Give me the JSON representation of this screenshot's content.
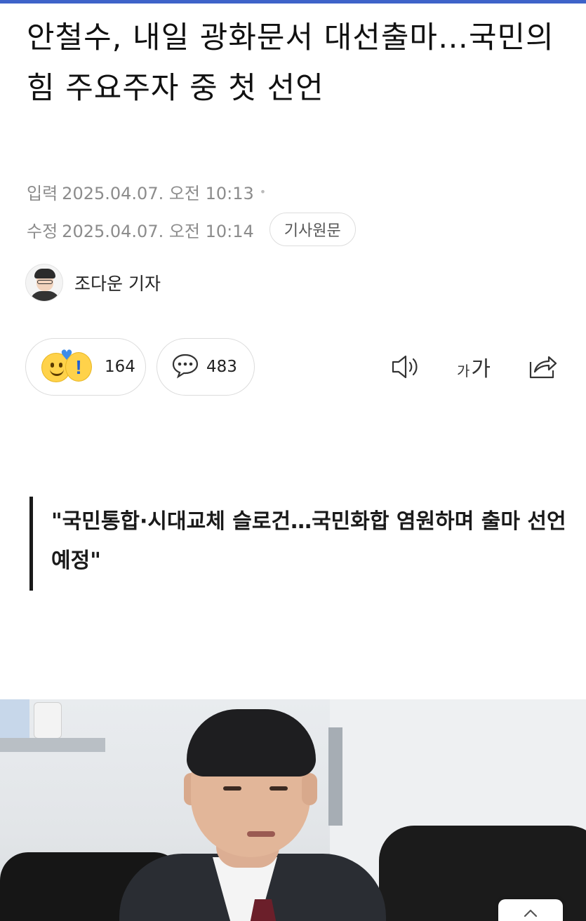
{
  "article": {
    "headline": "안철수, 내일 광화문서 대선출마…국민의힘 주요주자 중 첫 선언",
    "published_label": "입력",
    "published_value": "2025.04.07. 오전 10:13",
    "modified_label": "수정",
    "modified_value": "2025.04.07. 오전 10:14",
    "original_button": "기사원문",
    "author": "조다운 기자",
    "quote": "\"국민통합·시대교체 슬로건…국민화합 염원하며 출마 선언 예정\""
  },
  "actions": {
    "reaction_count": "164",
    "comment_count": "483",
    "font_size_large": "가",
    "font_size_small": "가"
  },
  "colors": {
    "accent": "#3e63c9",
    "quote_bar": "#1a1a1a",
    "meta_text": "#8c8c8c"
  },
  "icons": {
    "reaction": "reaction-emoji-icon",
    "comment": "speech-bubble-icon",
    "speaker": "speaker-icon",
    "font_size": "font-size-icon",
    "share": "share-icon",
    "scroll_top": "chevron-up-icon"
  }
}
